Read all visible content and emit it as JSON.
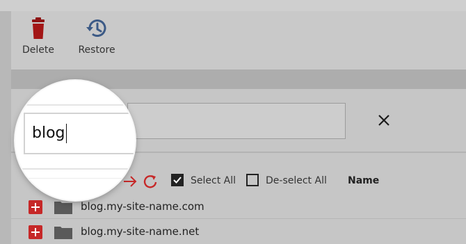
{
  "toolbar": {
    "delete_label": "Delete",
    "restore_label": "Restore",
    "delete_icon": "trash-icon",
    "restore_icon": "history-icon"
  },
  "search": {
    "value": "blog",
    "clear_icon": "close-icon"
  },
  "controls": {
    "select_all_label": "Select All",
    "deselect_all_label": "De-select All",
    "select_all_checked": true,
    "deselect_all_checked": false,
    "name_column": "Name"
  },
  "rows": [
    {
      "name": "blog.my-site-name.com",
      "icon": "folder-icon"
    },
    {
      "name": "blog.my-site-name.net",
      "icon": "folder-icon"
    }
  ],
  "colors": {
    "accent_red": "#c62828",
    "restore_blue": "#3c5a86",
    "folder_gray": "#5a5a5a"
  }
}
